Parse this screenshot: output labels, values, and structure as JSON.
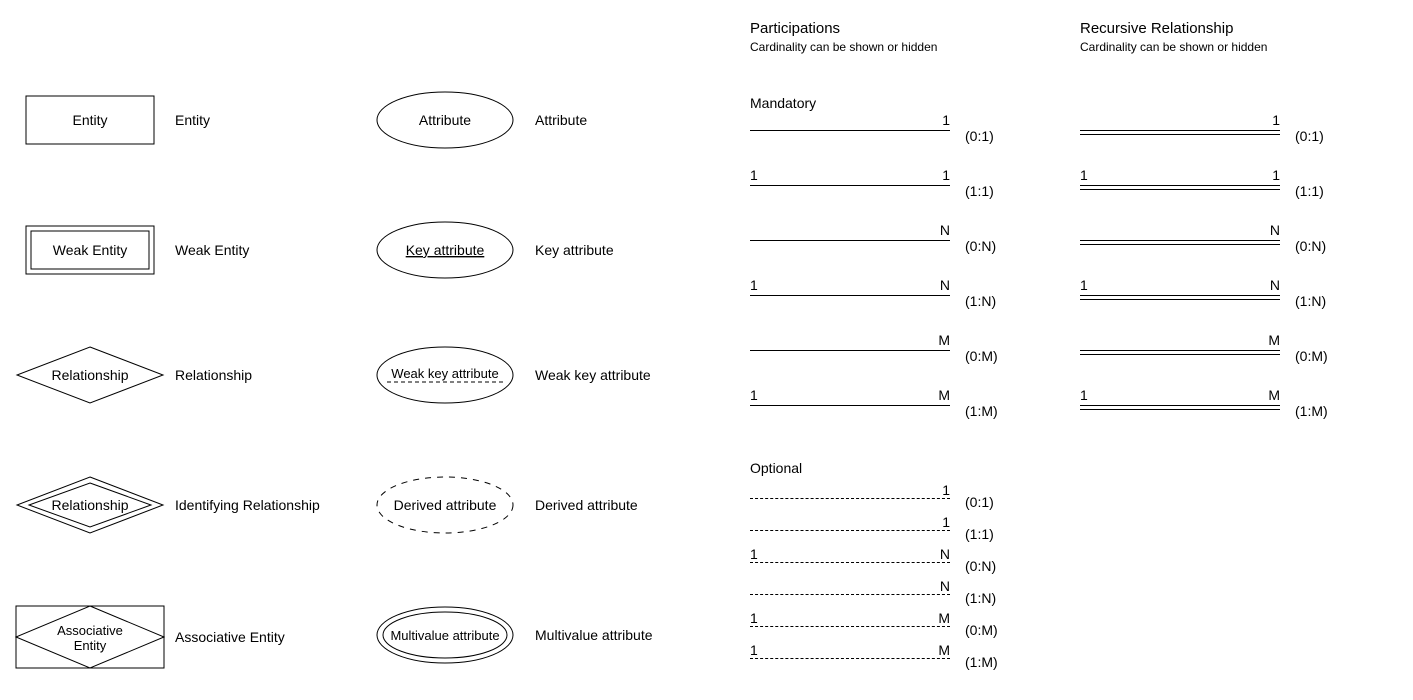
{
  "shapes_left": [
    {
      "symbol_text": "Entity",
      "label": "Entity"
    },
    {
      "symbol_text": "Weak Entity",
      "label": "Weak Entity"
    },
    {
      "symbol_text": "Relationship",
      "label": "Relationship"
    },
    {
      "symbol_text": "Relationship",
      "label": "Identifying Relationship"
    },
    {
      "symbol_text": "Associative\nEntity",
      "label": "Associative Entity"
    }
  ],
  "shapes_right": [
    {
      "symbol_text": "Attribute",
      "label": "Attribute"
    },
    {
      "symbol_text": "Key attribute",
      "label": "Key attribute"
    },
    {
      "symbol_text": "Weak key attribute",
      "label": "Weak key attribute"
    },
    {
      "symbol_text": "Derived attribute",
      "label": "Derived attribute"
    },
    {
      "symbol_text": "Multivalue attribute",
      "label": "Multivalue attribute"
    }
  ],
  "participations": {
    "title": "Participations",
    "subtitle": "Cardinality can be shown or hidden",
    "mandatory_label": "Mandatory",
    "optional_label": "Optional",
    "mandatory": [
      {
        "left": "",
        "right": "1",
        "card": "(0:1)"
      },
      {
        "left": "1",
        "right": "1",
        "card": "(1:1)"
      },
      {
        "left": "",
        "right": "N",
        "card": "(0:N)"
      },
      {
        "left": "1",
        "right": "N",
        "card": "(1:N)"
      },
      {
        "left": "",
        "right": "M",
        "card": "(0:M)"
      },
      {
        "left": "1",
        "right": "M",
        "card": "(1:M)"
      }
    ],
    "optional": [
      {
        "left": "",
        "right": "1",
        "card": "(0:1)"
      },
      {
        "left": "",
        "right": "1",
        "card": "(1:1)"
      },
      {
        "left": "1",
        "right": "N",
        "card": "(0:N)"
      },
      {
        "left": "",
        "right": "N",
        "card": "(1:N)"
      },
      {
        "left": "1",
        "right": "M",
        "card": "(0:M)"
      },
      {
        "left": "1",
        "right": "M",
        "card": "(1:M)"
      }
    ]
  },
  "recursive": {
    "title": "Recursive Relationship",
    "subtitle": "Cardinality can be shown or hidden",
    "rows": [
      {
        "left": "",
        "right": "1",
        "card": "(0:1)"
      },
      {
        "left": "1",
        "right": "1",
        "card": "(1:1)"
      },
      {
        "left": "",
        "right": "N",
        "card": "(0:N)"
      },
      {
        "left": "1",
        "right": "N",
        "card": "(1:N)"
      },
      {
        "left": "",
        "right": "M",
        "card": "(0:M)"
      },
      {
        "left": "1",
        "right": "M",
        "card": "(1:M)"
      }
    ]
  }
}
